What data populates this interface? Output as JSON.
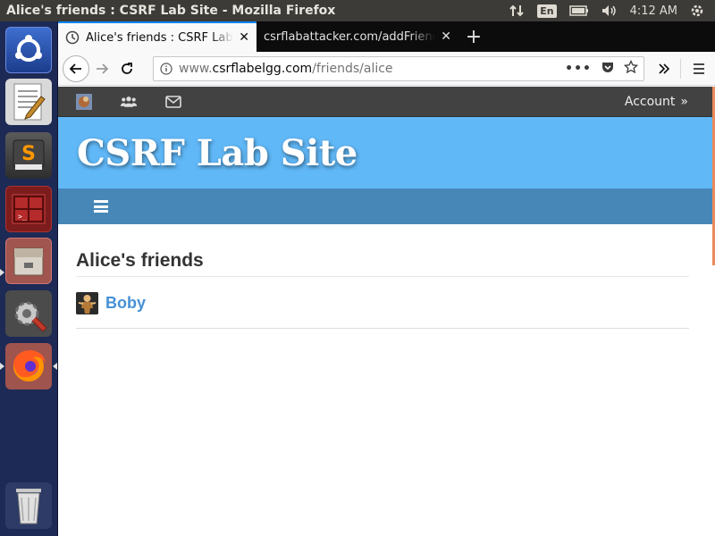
{
  "window": {
    "title": "Alice's friends : CSRF Lab Site - Mozilla Firefox"
  },
  "tray": {
    "keyboard_layout": "En",
    "clock": "4:12 AM"
  },
  "launcher": {
    "apps": [
      "ubuntu-dash-icon",
      "text-editor-icon",
      "sublime-text-icon",
      "terminal-icon",
      "files-icon",
      "system-settings-icon",
      "firefox-icon",
      "trash-icon"
    ]
  },
  "browser": {
    "tabs": [
      {
        "label": "Alice's friends : CSRF Lab Site",
        "active": true
      },
      {
        "label": "csrflabattacker.com/addFriend.html",
        "active": false
      }
    ],
    "url": {
      "prefix": "www.",
      "host": "csrflabelgg.com",
      "path": "/friends/alice"
    }
  },
  "site": {
    "topbar": {
      "account_label": "Account",
      "account_arrow": "»"
    },
    "name": "CSRF Lab Site",
    "page_title": "Alice's friends",
    "friends": [
      {
        "name": "Boby"
      }
    ]
  },
  "colors": {
    "header_bg": "#60b8f7",
    "nav_bg": "#4787b8",
    "topbar_bg": "#424242",
    "link": "#4690d6",
    "launcher_bg": "#1d2a55",
    "active_tab_accent": "#0a84ff"
  }
}
